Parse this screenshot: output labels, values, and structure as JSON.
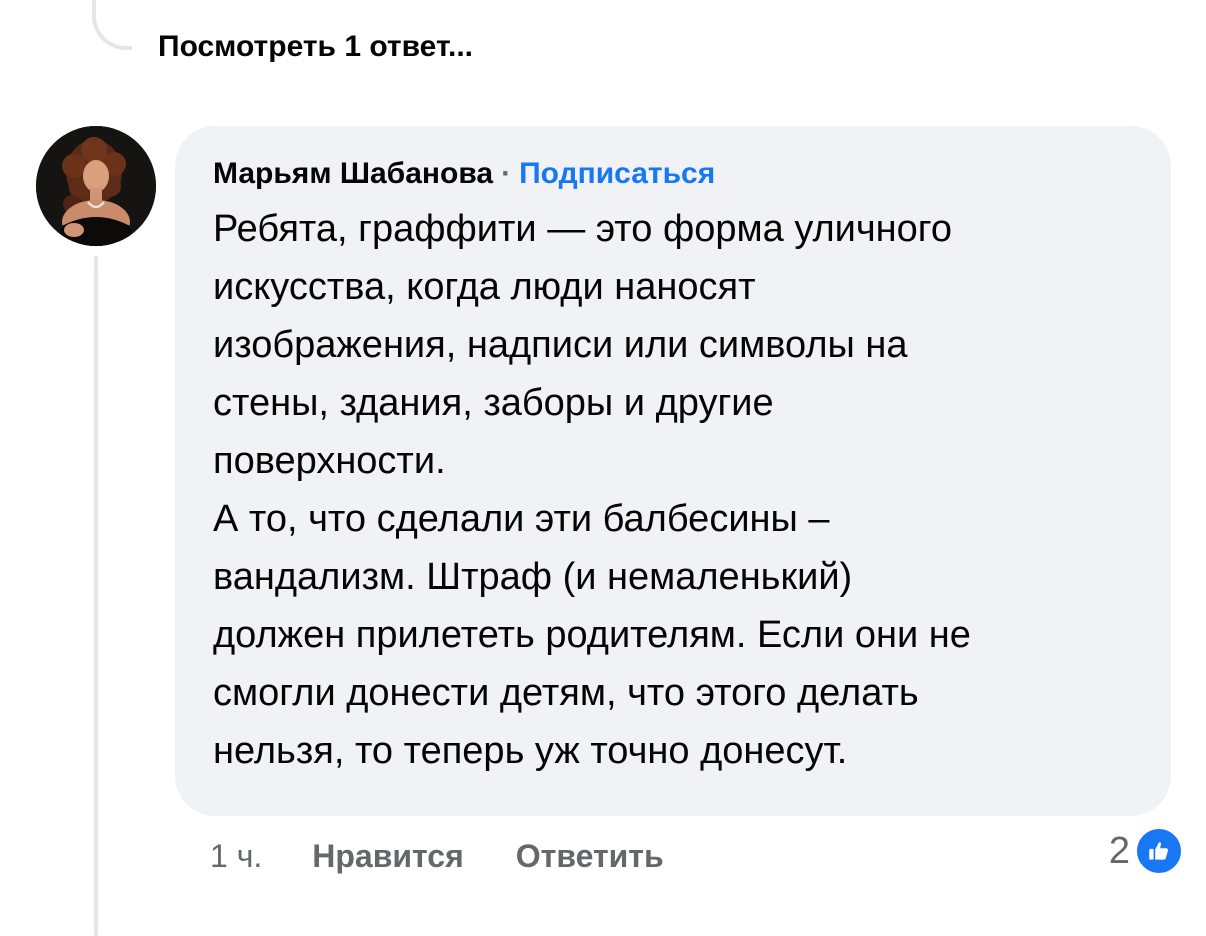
{
  "thread": {
    "view_replies_label": "Посмотреть 1 ответ..."
  },
  "comment": {
    "author": "Марьям Шабанова",
    "separator": "·",
    "follow_label": "Подписаться",
    "text": "Ребята, граффити — это форма уличного\nискусства, когда люди наносят\nизображения, надписи или символы на\nстены, здания, заборы и другие\nповерхности.\nА то, что сделали эти балбесины –\nвандализм. Штраф (и немаленький)\nдолжен прилететь родителям. Если они не\nсмогли донести детям, что этого делать\nнельзя, то теперь уж точно донесут.",
    "time": "1 ч.",
    "like_label": "Нравится",
    "reply_label": "Ответить",
    "reaction_count": "2",
    "reaction_icon": "thumbs-up-icon"
  },
  "colors": {
    "bubble_bg": "#f0f2f5",
    "accent": "#1877f2",
    "secondary_text": "#65676b",
    "primary_text": "#050505"
  }
}
